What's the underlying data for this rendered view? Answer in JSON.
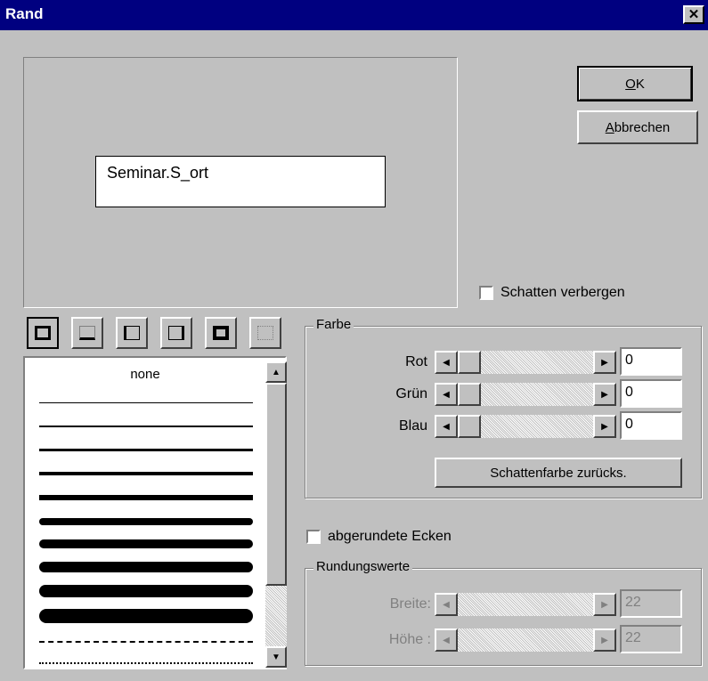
{
  "window": {
    "title": "Rand",
    "close_glyph": "✕"
  },
  "buttons": {
    "ok_label": "OK",
    "ok_mnemonic": "O",
    "ok_rest": "K",
    "cancel_label": "Abbrechen",
    "cancel_mnemonic": "A",
    "cancel_rest": "bbrechen"
  },
  "preview": {
    "field_text": "Seminar.S_ort"
  },
  "shadow": {
    "hide_label": "Schatten verbergen",
    "checked": false
  },
  "border_toolbar": [
    "border-all-icon",
    "border-bottom-icon",
    "border-left-icon",
    "border-right-icon",
    "border-thick-icon",
    "border-none-icon"
  ],
  "line_styles": {
    "first_item": "none"
  },
  "farbe": {
    "legend": "Farbe",
    "rot_label": "Rot",
    "rot_value": "0",
    "gruen_label": "Grün",
    "gruen_value": "0",
    "blau_label": "Blau",
    "blau_value": "0",
    "reset_label": "Schattenfarbe zurücks."
  },
  "rounded": {
    "label": "abgerundete Ecken",
    "checked": false
  },
  "rundung": {
    "legend": "Rundungswerte",
    "breite_label": "Breite:",
    "breite_value": "22",
    "hoehe_label": "Höhe :",
    "hoehe_value": "22"
  }
}
